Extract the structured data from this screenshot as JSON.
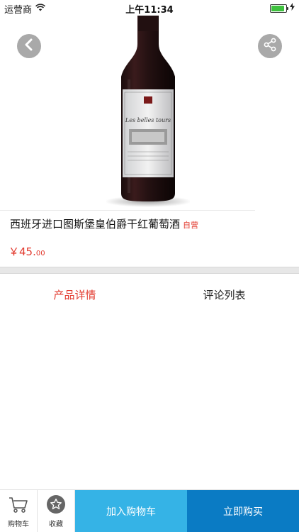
{
  "status": {
    "carrier": "运营商",
    "time": "上午11:34",
    "battery_level": 0.9
  },
  "product": {
    "title": "西班牙进口图斯堡皇伯爵干红葡萄酒",
    "self_operated": "自营",
    "price_main": "￥45.",
    "price_cents": "00",
    "label_text": "Les belles tours",
    "image_desc_icon": "wine-bottle"
  },
  "tabs": [
    {
      "label": "产品详情",
      "active": true
    },
    {
      "label": "评论列表",
      "active": false
    }
  ],
  "bottom_bar": {
    "cart_label": "购物车",
    "favorite_label": "收藏",
    "add_cart_label": "加入购物车",
    "buy_now_label": "立即购买"
  },
  "colors": {
    "accent_red": "#e23a2e",
    "add_cart_bg": "#35b3e6",
    "buy_now_bg": "#0a7bc4"
  }
}
